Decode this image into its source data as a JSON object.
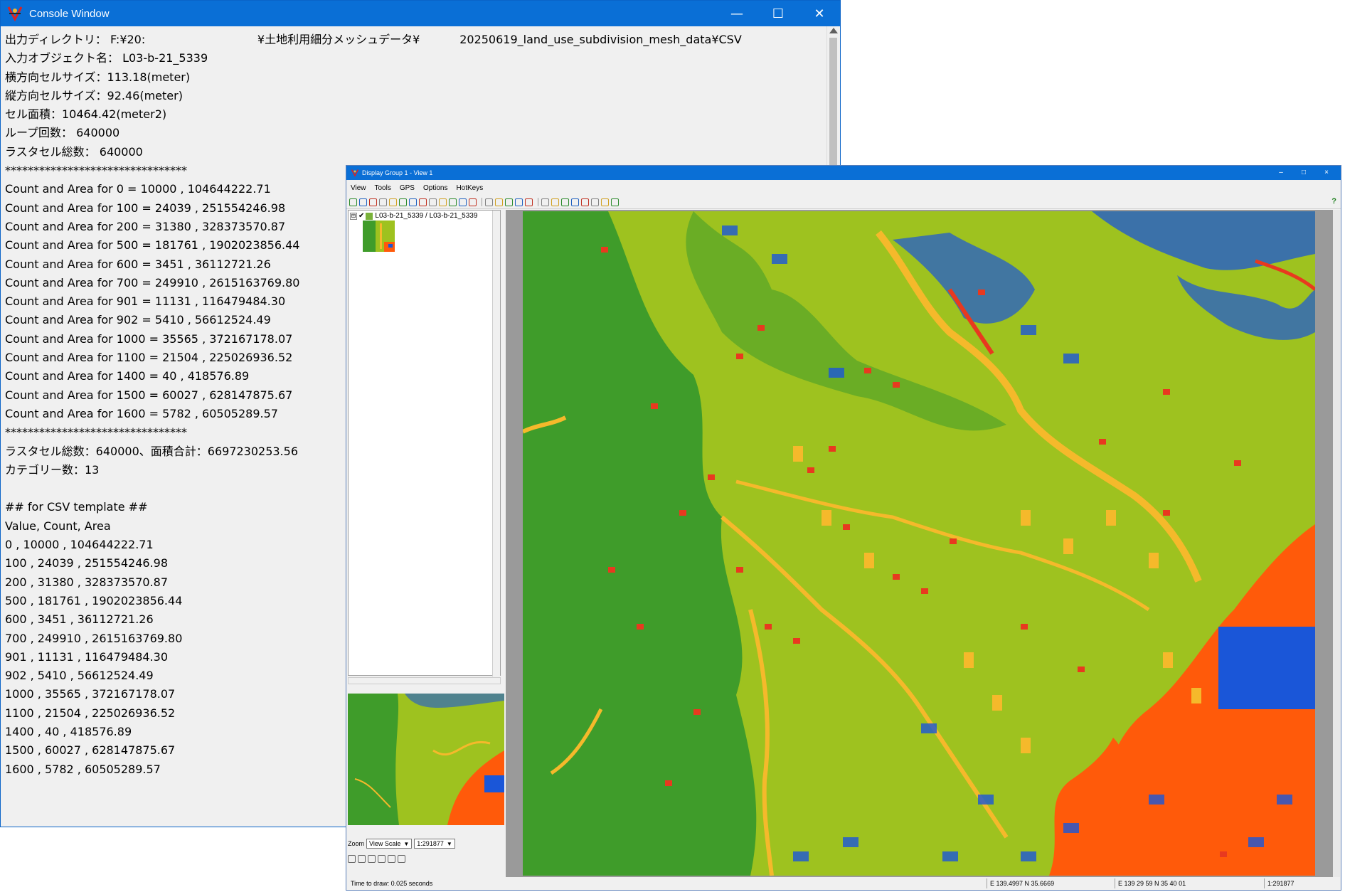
{
  "console": {
    "title": "Console Window",
    "controls": {
      "minimize": "—",
      "maximize": "☐",
      "close": "✕"
    },
    "lines": [
      "出力ディレクトリ： F:¥20:                               ¥土地利用細分メッシュデータ¥           20250619_land_use_subdivision_mesh_data¥CSV",
      "入力オブジェクト名： L03-b-21_5339",
      "横方向セルサイズ：113.18(meter)",
      "縦方向セルサイズ：92.46(meter)",
      "セル面積：10464.42(meter2)",
      "ループ回数： 640000",
      "ラスタセル総数： 640000",
      "********************************",
      "Count and Area for 0 = 10000 , 104644222.71",
      "Count and Area for 100 = 24039 , 251554246.98",
      "Count and Area for 200 = 31380 , 328373570.87",
      "Count and Area for 500 = 181761 , 1902023856.44",
      "Count and Area for 600 = 3451 , 36112721.26",
      "Count and Area for 700 = 249910 , 2615163769.80",
      "Count and Area for 901 = 11131 , 116479484.30",
      "Count and Area for 902 = 5410 , 56612524.49",
      "Count and Area for 1000 = 35565 , 372167178.07",
      "Count and Area for 1100 = 21504 , 225026936.52",
      "Count and Area for 1400 = 40 , 418576.89",
      "Count and Area for 1500 = 60027 , 628147875.67",
      "Count and Area for 1600 = 5782 , 60505289.57",
      "********************************",
      "ラスタセル総数：640000、面積合計：6697230253.56",
      "カテゴリー数：13",
      "",
      "## for CSV template ##",
      "Value, Count, Area",
      "0 , 10000 , 104644222.71",
      "100 , 24039 , 251554246.98",
      "200 , 31380 , 328373570.87",
      "500 , 181761 , 1902023856.44",
      "600 , 3451 , 36112721.26",
      "700 , 249910 , 2615163769.80",
      "901 , 11131 , 116479484.30",
      "902 , 5410 , 56612524.49",
      "1000 , 35565 , 372167178.07",
      "1100 , 21504 , 225026936.52",
      "1400 , 40 , 418576.89",
      "1500 , 60027 , 628147875.67",
      "1600 , 5782 , 60505289.57"
    ]
  },
  "display": {
    "title": "Display Group 1 - View 1",
    "controls": {
      "minimize": "–",
      "maximize": "□",
      "close": "×"
    },
    "menu": [
      "View",
      "Tools",
      "GPS",
      "Options",
      "HotKeys"
    ],
    "help": "?",
    "layer": {
      "expand": "⊟",
      "check": "✔",
      "name": "L03-b-21_5339 / L03-b-21_5339"
    },
    "zoom": {
      "label": "Zoom",
      "mode": "View Scale",
      "scale": "1:291877"
    },
    "status": {
      "draw_time": "Time to draw: 0.025 seconds",
      "coord_decimal": "E 139.4997  N 35.6669",
      "coord_dms": "E 139 29 59  N 35 40 01",
      "scale": "1:291877"
    }
  },
  "colors": {
    "title_blue": "#0a6fd6",
    "forest": "#3f9c2a",
    "farmland": "#9ec21f",
    "urban_yellow": "#f5b92b",
    "water_blue": "#1a56d8",
    "sea_orange": "#ff5a0a",
    "red": "#e8391f"
  },
  "icons": {
    "app": "globe-app-icon",
    "toolbar_count": 26
  }
}
